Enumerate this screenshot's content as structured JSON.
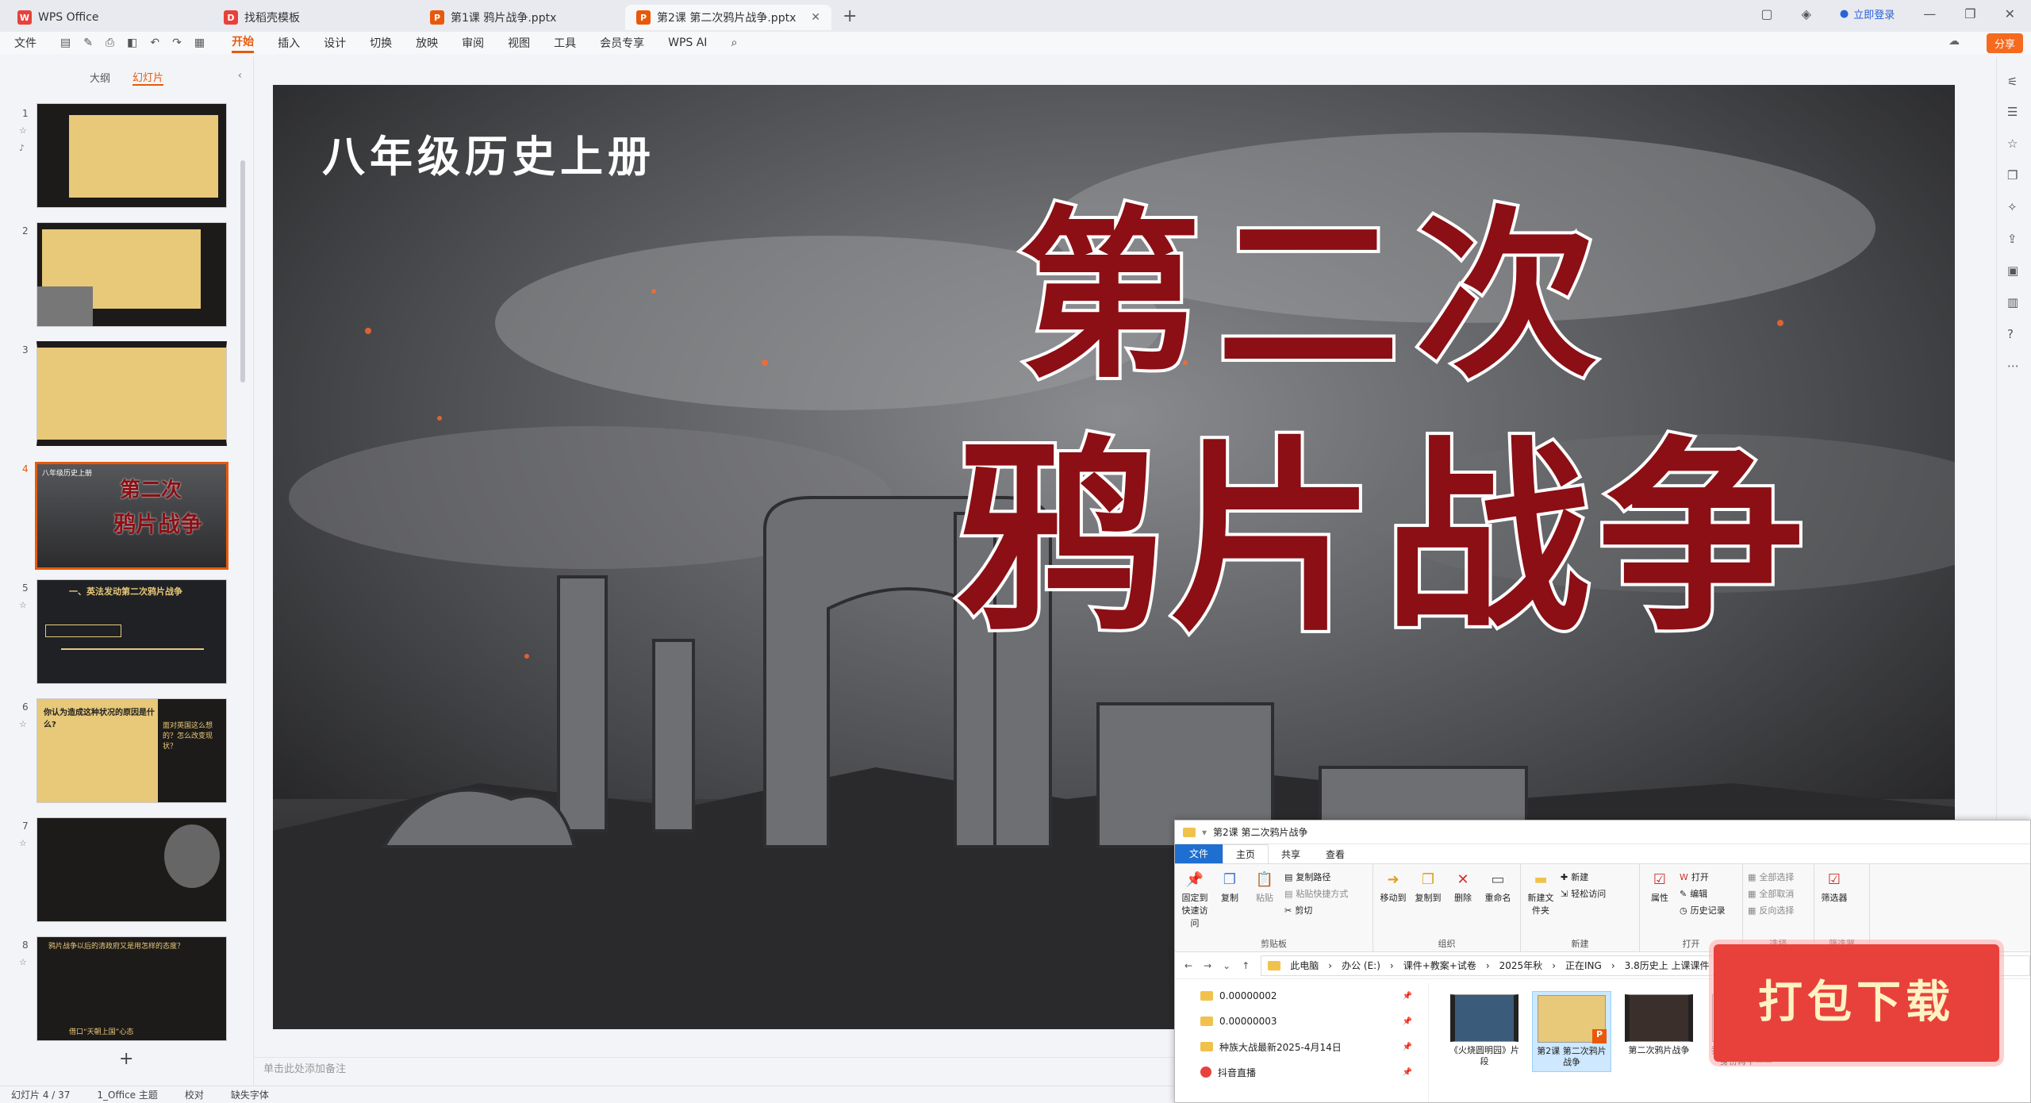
{
  "tabs": [
    {
      "label": "WPS Office",
      "icon": "wps-logo-icon",
      "color": "#e8413b"
    },
    {
      "label": "找稻壳模板",
      "icon": "docer-icon",
      "color": "#e8413b"
    },
    {
      "label": "第1课 鸦片战争.pptx",
      "icon": "ppt-icon",
      "color": "#e8590c"
    },
    {
      "label": "第2课 第二次鸦片战争.pptx",
      "icon": "ppt-icon",
      "color": "#e8590c"
    }
  ],
  "login": "立即登录",
  "menu": {
    "file": "文件",
    "items": [
      "开始",
      "插入",
      "设计",
      "切换",
      "放映",
      "审阅",
      "视图",
      "工具",
      "会员专享",
      "WPS AI"
    ],
    "active": "开始",
    "share": "分享"
  },
  "left": {
    "tab_outline": "大纲",
    "tab_slides": "幻灯片",
    "slide_numbers": [
      "1",
      "2",
      "3",
      "4",
      "5",
      "6",
      "7",
      "8"
    ],
    "add": "+"
  },
  "slide": {
    "top_title": "八年级历史上册",
    "big_line1": "第二次",
    "big_line2": "鸦片战争"
  },
  "thumbs": {
    "t4_small": "八年级历史上册",
    "t4_big1": "第二次",
    "t4_big2": "鸦片战争",
    "t5_title": "一、英法发动第二次鸦片战争",
    "t6_q1": "你认为造成这种状况的原因是什么?",
    "t6_q2": "面对英国这么想的？怎么改变现状？",
    "t8_title": "鸦片战争以后的清政府又是用怎样的态度？",
    "t8_foot": "借口“天朝上国”心态"
  },
  "notes": "单击此处添加备注",
  "status": {
    "slide": "幻灯片 4 / 37",
    "theme": "1_Office 主题",
    "proof": "校对",
    "font": "缺失字体"
  },
  "explorer": {
    "title": "第2课 第二次鸦片战争",
    "menu": [
      "文件",
      "主页",
      "共享",
      "查看"
    ],
    "ribbon": {
      "clipboard": {
        "label": "剪贴板",
        "pin": "固定到快速访问",
        "copy": "复制",
        "paste": "粘贴",
        "copy_path": "复制路径",
        "paste_shortcut": "粘贴快捷方式",
        "cut": "剪切"
      },
      "organize": {
        "label": "组织",
        "move": "移动到",
        "copyto": "复制到",
        "delete": "删除",
        "rename": "重命名"
      },
      "new": {
        "label": "新建",
        "newfolder": "新建文件夹",
        "newitem": "新建",
        "easy": "轻松访问"
      },
      "open": {
        "label": "打开",
        "props": "属性",
        "open": "打开",
        "edit": "编辑",
        "history": "历史记录"
      },
      "select": {
        "label": "选择",
        "all": "全部选择",
        "none": "全部取消",
        "invert": "反向选择"
      },
      "filter": {
        "label": "筛选器",
        "btn": "筛选器"
      }
    },
    "path": [
      "此电脑",
      "办公 (E:)",
      "课件+教案+试卷",
      "2025年秋",
      "正在ING",
      "3.8历史上 上课课件"
    ],
    "nav": [
      "0.00000002",
      "0.00000003",
      "种族大战最新2025-4月14日",
      "抖音直播"
    ],
    "files": [
      {
        "name": "《火烧圆明园》片段",
        "type": "video"
      },
      {
        "name": "第2课 第二次鸦片战争",
        "type": "ppt"
      },
      {
        "name": "第二次鸦片战争",
        "type": "video"
      },
      {
        "name": "我希望你以军人的身份再牛——",
        "type": "doc"
      }
    ]
  },
  "download_badge": "打包下载",
  "colors": {
    "accent": "#e8590c",
    "title_red": "#8b0f14",
    "slide_gold": "#e8c879"
  }
}
